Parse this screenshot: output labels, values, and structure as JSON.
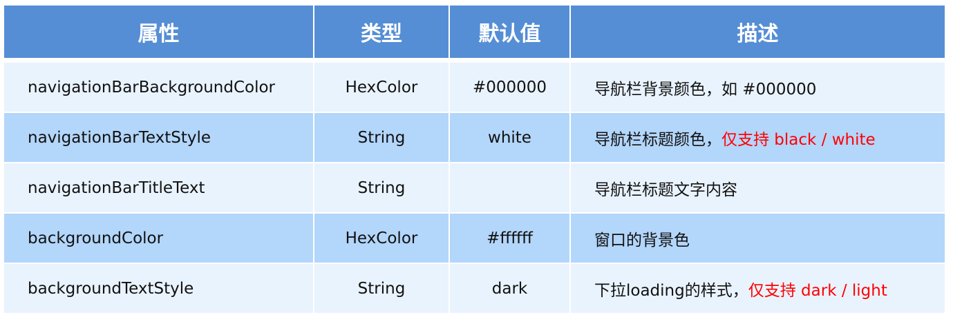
{
  "headers": [
    "属性",
    "类型",
    "默认值",
    "描述"
  ],
  "rows": [
    {
      "name": "navigationBarBackgroundColor",
      "type": "HexColor",
      "default": "#000000",
      "desc": "导航栏背景颜色，如 #000000",
      "desc_red": ""
    },
    {
      "name": "navigationBarTextStyle",
      "type": "String",
      "default": "white",
      "desc": "导航栏标题颜色，",
      "desc_red": "仅支持 black / white"
    },
    {
      "name": "navigationBarTitleText",
      "type": "String",
      "default": "",
      "desc": "导航栏标题文字内容",
      "desc_red": ""
    },
    {
      "name": "backgroundColor",
      "type": "HexColor",
      "default": "#ffffff",
      "desc": "窗口的背景色",
      "desc_red": ""
    },
    {
      "name": "backgroundTextStyle",
      "type": "String",
      "default": "dark",
      "desc": "下拉loading的样式，",
      "desc_red": "仅支持 dark / light"
    }
  ],
  "colors": {
    "header": "#558ed5",
    "row_light": "#e9f3fe",
    "row_dark": "#b3d6fb",
    "highlight": "#ff0000"
  }
}
